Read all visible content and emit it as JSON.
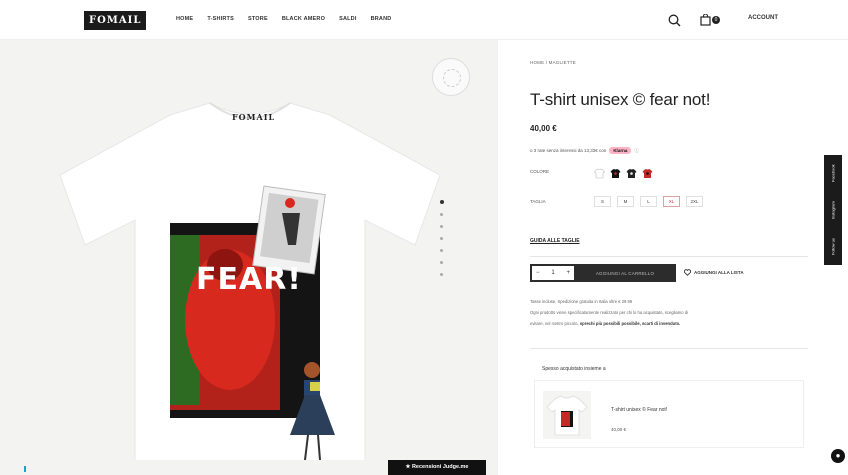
{
  "header": {
    "logo_text": "FOMAIL",
    "nav": [
      "HOME",
      "T-SHIRTS",
      "STORE",
      "BLACK AMERO",
      "SALDI",
      "BRAND"
    ],
    "account_label": "ACCOUNT",
    "cart_count": "0"
  },
  "product": {
    "breadcrumb": "HOME  /  MAGLIETTE",
    "title": "T-shirt unisex © fear not!",
    "price": "40,00 €",
    "installments_text": "o 3 rate senza interessi da 13,33€ con",
    "klarna_label": "Klarna",
    "color_label": "COLORE",
    "size_label": "TAGLIA",
    "sizes": [
      "S",
      "M",
      "L",
      "XL",
      "2XL"
    ],
    "size_guide": "GUIDA ALLE TAGLIE",
    "qty": "1",
    "add_to_cart": "AGGIUNGI AL CARRELLO",
    "wishlist": "AGGIUNGI ALLA LISTA",
    "info_line1": "Tasse incluse. Spedizione gratuita in Italia oltre € 29.99",
    "info_line2": "Ogni prodotto viene specificatamente realizzato per chi lo ha acquistato, scegliamo di",
    "info_line3a": "evitare, nel nostro piccolo,",
    "info_line3b": "sprechi più possibili possibile, scarti di invenduto.",
    "tshirt_fear_text": "FEAR!",
    "tshirt_logo_text": "FOMAIL"
  },
  "related": {
    "title": "Spesso acquistato insieme a",
    "name": "T-shirt unisex © Fear not!",
    "price": "40,00 €"
  },
  "reviews_button": "★ Recensioni Judge.me",
  "social": [
    "Follow us",
    "Instagram",
    "Facebook"
  ],
  "colors": {
    "swatch_black": "#111111",
    "swatch_red": "#c62828",
    "swatch_white": "#ffffff"
  }
}
